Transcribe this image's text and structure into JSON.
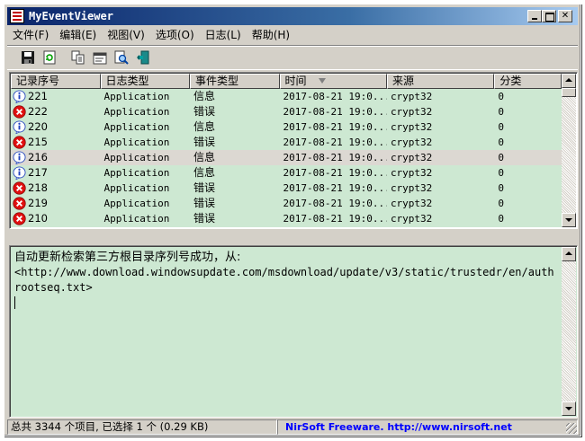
{
  "window": {
    "title": "MyEventViewer",
    "min_label": "",
    "max_label": "",
    "close_label": "✕"
  },
  "menu": [
    {
      "label": "文件(F)"
    },
    {
      "label": "编辑(E)"
    },
    {
      "label": "视图(V)"
    },
    {
      "label": "选项(O)"
    },
    {
      "label": "日志(L)"
    },
    {
      "label": "帮助(H)"
    }
  ],
  "toolbar": {
    "icons": [
      "save-icon",
      "refresh-icon",
      "copy-icon",
      "properties-icon",
      "find-icon",
      "exit-icon"
    ]
  },
  "list": {
    "columns": [
      {
        "label": "记录序号"
      },
      {
        "label": "日志类型"
      },
      {
        "label": "事件类型"
      },
      {
        "label": "时间"
      },
      {
        "label": "来源"
      },
      {
        "label": "分类"
      }
    ],
    "sorted_column": "时间",
    "rows": [
      {
        "icon": "info",
        "id": "221",
        "log": "Application",
        "type": "信息",
        "time": "2017-08-21 19:0...",
        "source": "crypt32",
        "category": "0",
        "selected": false
      },
      {
        "icon": "error",
        "id": "222",
        "log": "Application",
        "type": "错误",
        "time": "2017-08-21 19:0...",
        "source": "crypt32",
        "category": "0",
        "selected": false
      },
      {
        "icon": "info",
        "id": "220",
        "log": "Application",
        "type": "信息",
        "time": "2017-08-21 19:0...",
        "source": "crypt32",
        "category": "0",
        "selected": false
      },
      {
        "icon": "error",
        "id": "215",
        "log": "Application",
        "type": "错误",
        "time": "2017-08-21 19:0...",
        "source": "crypt32",
        "category": "0",
        "selected": false
      },
      {
        "icon": "info",
        "id": "216",
        "log": "Application",
        "type": "信息",
        "time": "2017-08-21 19:0...",
        "source": "crypt32",
        "category": "0",
        "selected": true
      },
      {
        "icon": "info",
        "id": "217",
        "log": "Application",
        "type": "信息",
        "time": "2017-08-21 19:0...",
        "source": "crypt32",
        "category": "0",
        "selected": false
      },
      {
        "icon": "error",
        "id": "218",
        "log": "Application",
        "type": "错误",
        "time": "2017-08-21 19:0...",
        "source": "crypt32",
        "category": "0",
        "selected": false
      },
      {
        "icon": "error",
        "id": "219",
        "log": "Application",
        "type": "错误",
        "time": "2017-08-21 19:0...",
        "source": "crypt32",
        "category": "0",
        "selected": false
      },
      {
        "icon": "error",
        "id": "210",
        "log": "Application",
        "type": "错误",
        "time": "2017-08-21 19:0...",
        "source": "crypt32",
        "category": "0",
        "selected": false
      }
    ]
  },
  "description": {
    "line1": "自动更新检索第三方根目录序列号成功，从:",
    "line2": "<http://www.download.windowsupdate.com/msdownload/update/v3/static/trustedr/en/authrootseq.txt>"
  },
  "status": {
    "summary": "总共 3344 个项目, 已选择 1 个  (0.29 KB)",
    "link": "NirSoft Freeware.  http://www.nirsoft.net"
  },
  "colors": {
    "row_background": "#cde8d2",
    "selected_row": "#dcd8d2",
    "title_gradient_start": "#0a246a",
    "link": "#0000ff"
  }
}
